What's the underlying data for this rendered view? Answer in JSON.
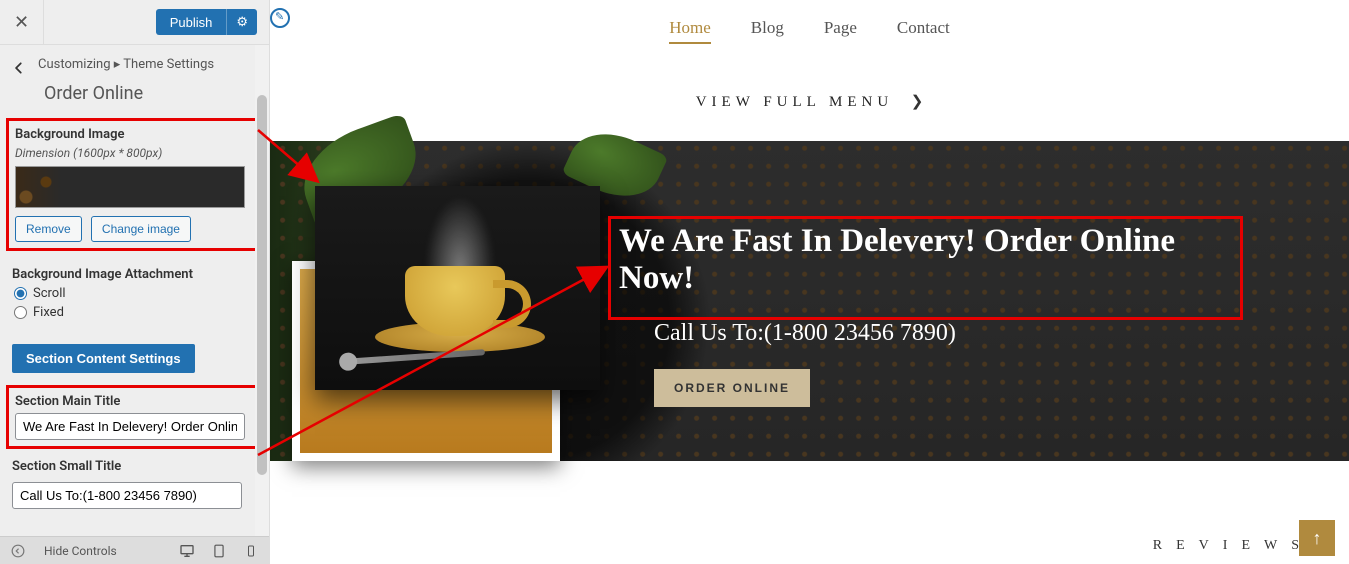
{
  "sidebar": {
    "publish_label": "Publish",
    "breadcrumb_prefix": "Customizing",
    "breadcrumb_sep": "▸",
    "breadcrumb_section": "Theme Settings",
    "section_title": "Order Online",
    "bg_image": {
      "label": "Background Image",
      "dimension": "Dimension (1600px * 800px)",
      "remove_label": "Remove",
      "change_label": "Change image"
    },
    "attachment": {
      "label": "Background Image Attachment",
      "options": [
        "Scroll",
        "Fixed"
      ],
      "selected": "Scroll"
    },
    "content_settings_label": "Section Content Settings",
    "main_title": {
      "label": "Section Main Title",
      "value": "We Are Fast In Delevery! Order Online"
    },
    "small_title": {
      "label": "Section Small Title",
      "value": "Call Us To:(1-800 23456 7890)"
    },
    "footer": {
      "hide_controls": "Hide Controls"
    }
  },
  "preview": {
    "nav": {
      "items": [
        "Home",
        "Blog",
        "Page",
        "Contact"
      ],
      "active": "Home"
    },
    "view_full_menu": "VIEW FULL MENU",
    "hero": {
      "title": "We Are Fast In Delevery! Order Online Now!",
      "subtitle": "Call Us To:(1-800 23456 7890)",
      "button": "ORDER ONLINE"
    },
    "reviews_label": "REVIEWS"
  }
}
